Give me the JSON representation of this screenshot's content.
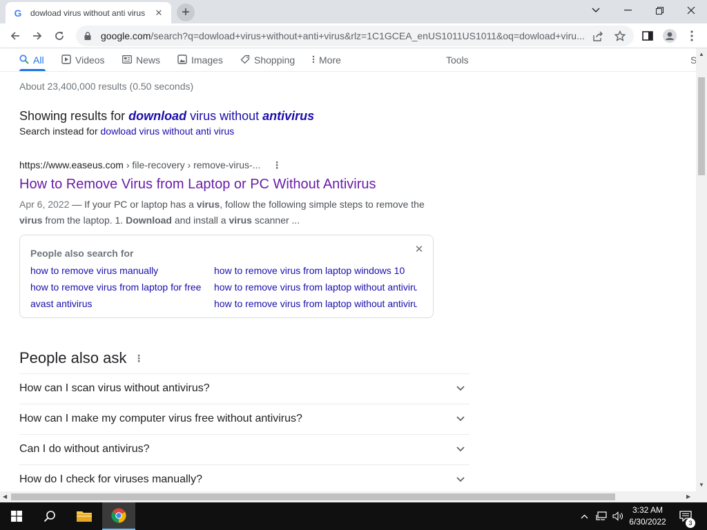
{
  "browser": {
    "tab_title": "dowload virus without anti virus",
    "tab_favicon": "G",
    "url_host": "google.com",
    "url_rest": "/search?q=dowload+virus+without+anti+virus&rlz=1C1GCEA_enUS1011US1011&oq=dowload+viru...",
    "icons": {
      "back": "back-arrow-icon",
      "forward": "forward-arrow-icon",
      "reload": "reload-icon",
      "lock": "lock-icon",
      "share": "share-icon",
      "bookmark": "star-icon",
      "sidepanel": "side-panel-icon",
      "profile": "profile-icon",
      "menu": "kebab-menu-icon"
    }
  },
  "search_nav": {
    "tabs": [
      {
        "label": "All",
        "icon": "search-icon",
        "active": true
      },
      {
        "label": "Videos",
        "icon": "video-icon"
      },
      {
        "label": "News",
        "icon": "news-icon"
      },
      {
        "label": "Images",
        "icon": "image-icon"
      },
      {
        "label": "Shopping",
        "icon": "tag-icon"
      },
      {
        "label": "More",
        "icon": "more-dots-icon"
      }
    ],
    "tools_label": "Tools",
    "cut_label": "S"
  },
  "results": {
    "stats": "About 23,400,000 results (0.50 seconds)",
    "showing_prefix": "Showing results for ",
    "showing_q1": "download",
    "showing_q2": " virus without ",
    "showing_q3": "antivirus",
    "instead_prefix": "Search instead for ",
    "instead_link": "dowload virus without anti virus",
    "result1": {
      "cite_host": "https://www.easeus.com",
      "cite_path": " › file-recovery › remove-virus-...",
      "title": "How to Remove Virus from Laptop or PC Without Antivirus",
      "date": "Apr 6, 2022",
      "s1": " — If your PC or laptop has a ",
      "b1": "virus",
      "s2": ", follow the following simple steps to remove the ",
      "b2": "virus",
      "s3": " from the laptop. 1. ",
      "b3": "Download",
      "s4": " and install a ",
      "b4": "virus",
      "s5": " scanner ..."
    }
  },
  "people_also_search": {
    "title": "People also search for",
    "left": [
      "how to remove virus manually",
      "how to remove virus from laptop for free",
      "avast antivirus"
    ],
    "right": [
      "how to remove virus from laptop windows 10",
      "how to remove virus from laptop without antivirus",
      "how to remove virus from laptop without antivirus"
    ]
  },
  "people_also_ask": {
    "title": "People also ask",
    "questions": [
      "How can I scan virus without antivirus?",
      "How can I make my computer virus free without antivirus?",
      "Can I do without antivirus?",
      "How do I check for viruses manually?"
    ]
  },
  "taskbar": {
    "time": "3:32 AM",
    "date": "6/30/2022",
    "notification_count": "3",
    "accent": "#76b9ed"
  }
}
